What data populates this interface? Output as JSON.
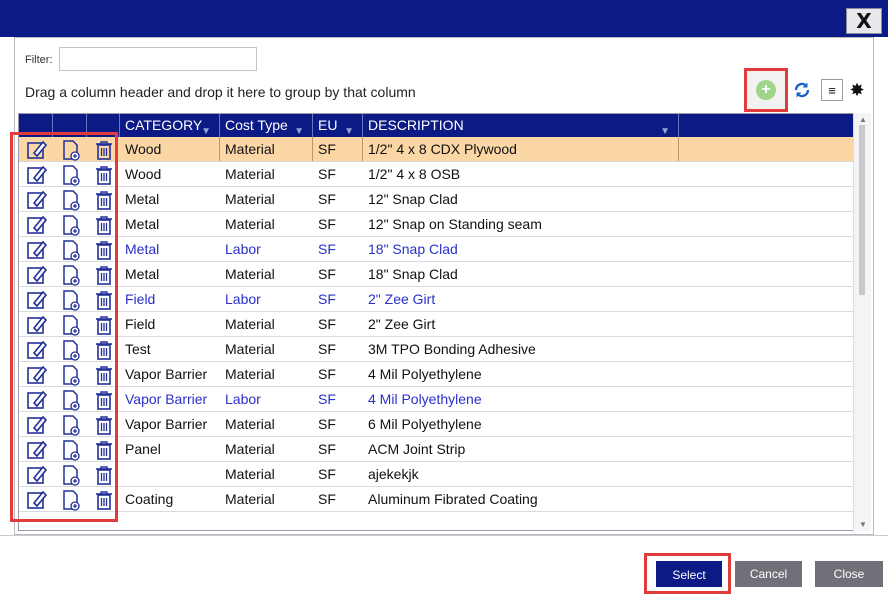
{
  "dialog": {
    "close_glyph": "X"
  },
  "filter": {
    "label": "Filter:",
    "value": "",
    "placeholder": ""
  },
  "group_hint": "Drag a column header and drop it here to group by that column",
  "toolbar": {
    "add_icon": "add-circle-icon",
    "refresh_icon": "refresh-icon",
    "columns_icon": "columns-icon",
    "settings_icon": "gear-icon"
  },
  "columns": [
    "CATEGORY",
    "Cost Type",
    "EU",
    "DESCRIPTION"
  ],
  "rows": [
    {
      "category": "Wood",
      "cost_type": "Material",
      "eu": "SF",
      "description": "1/2\" 4 x 8 CDX Plywood"
    },
    {
      "category": "Wood",
      "cost_type": "Material",
      "eu": "SF",
      "description": "1/2\" 4 x 8 OSB"
    },
    {
      "category": "Metal",
      "cost_type": "Material",
      "eu": "SF",
      "description": "12\"  Snap Clad"
    },
    {
      "category": "Metal",
      "cost_type": "Material",
      "eu": "SF",
      "description": "12\"  Snap on Standing seam"
    },
    {
      "category": "Metal",
      "cost_type": "Labor",
      "eu": "SF",
      "description": "18\"  Snap Clad"
    },
    {
      "category": "Metal",
      "cost_type": "Material",
      "eu": "SF",
      "description": "18\"  Snap Clad"
    },
    {
      "category": "Field",
      "cost_type": "Labor",
      "eu": "SF",
      "description": "2\" Zee Girt"
    },
    {
      "category": "Field",
      "cost_type": "Material",
      "eu": "SF",
      "description": "2\" Zee Girt"
    },
    {
      "category": "Test",
      "cost_type": "Material",
      "eu": "SF",
      "description": "3M TPO Bonding Adhesive"
    },
    {
      "category": "Vapor Barrier",
      "cost_type": "Material",
      "eu": "SF",
      "description": "4 Mil Polyethylene"
    },
    {
      "category": "Vapor Barrier",
      "cost_type": "Labor",
      "eu": "SF",
      "description": "4 Mil Polyethylene"
    },
    {
      "category": "Vapor Barrier",
      "cost_type": "Material",
      "eu": "SF",
      "description": "6 Mil Polyethylene"
    },
    {
      "category": "Panel",
      "cost_type": "Material",
      "eu": "SF",
      "description": "ACM Joint Strip"
    },
    {
      "category": "",
      "cost_type": "Material",
      "eu": "SF",
      "description": "ajekekjk"
    },
    {
      "category": "Coating",
      "cost_type": "Material",
      "eu": "SF",
      "description": "Aluminum Fibrated Coating"
    }
  ],
  "selected_row": 0,
  "buttons": {
    "select": "Select",
    "cancel": "Cancel",
    "close": "Close"
  },
  "colors": {
    "header": "#0c1a86",
    "selected_row": "#fbd7a6",
    "labor_text": "#2a30c8",
    "highlight": "#e23b3b",
    "icon_stroke": "#23309a"
  }
}
